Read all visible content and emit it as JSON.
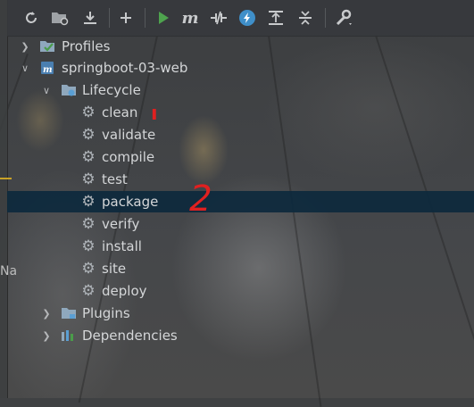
{
  "toolbar": {
    "buttons": [
      {
        "name": "reload-all-maven-projects",
        "icon": "refresh-icon"
      },
      {
        "name": "generate-sources",
        "icon": "folder-refresh-icon"
      },
      {
        "name": "download-sources",
        "icon": "download-icon"
      },
      {
        "name": "add-maven-project",
        "icon": "plus-icon"
      },
      {
        "name": "run-maven-build",
        "icon": "play-icon"
      },
      {
        "name": "execute-maven-goal",
        "icon": "maven-m-icon"
      },
      {
        "name": "toggle-offline-mode",
        "icon": "offline-icon"
      },
      {
        "name": "skip-tests",
        "icon": "bolt-icon"
      },
      {
        "name": "show-dependencies",
        "icon": "dependencies-icon"
      },
      {
        "name": "collapse-all",
        "icon": "collapse-icon"
      },
      {
        "name": "maven-settings",
        "icon": "wrench-icon"
      }
    ]
  },
  "tree": {
    "profiles": "Profiles",
    "project": "springboot-03-web",
    "lifecycle": "Lifecycle",
    "goals": [
      "clean",
      "validate",
      "compile",
      "test",
      "package",
      "verify",
      "install",
      "site",
      "deploy"
    ],
    "plugins": "Plugins",
    "dependencies": "Dependencies",
    "selected_goal": "package"
  },
  "left_strip": {
    "clipped_text": "Na"
  },
  "annotations": {
    "mark_one": "ı",
    "mark_two": "2"
  },
  "colors": {
    "selection": "#0d293d",
    "annotation": "#e02020",
    "run": "#4ea34e"
  }
}
